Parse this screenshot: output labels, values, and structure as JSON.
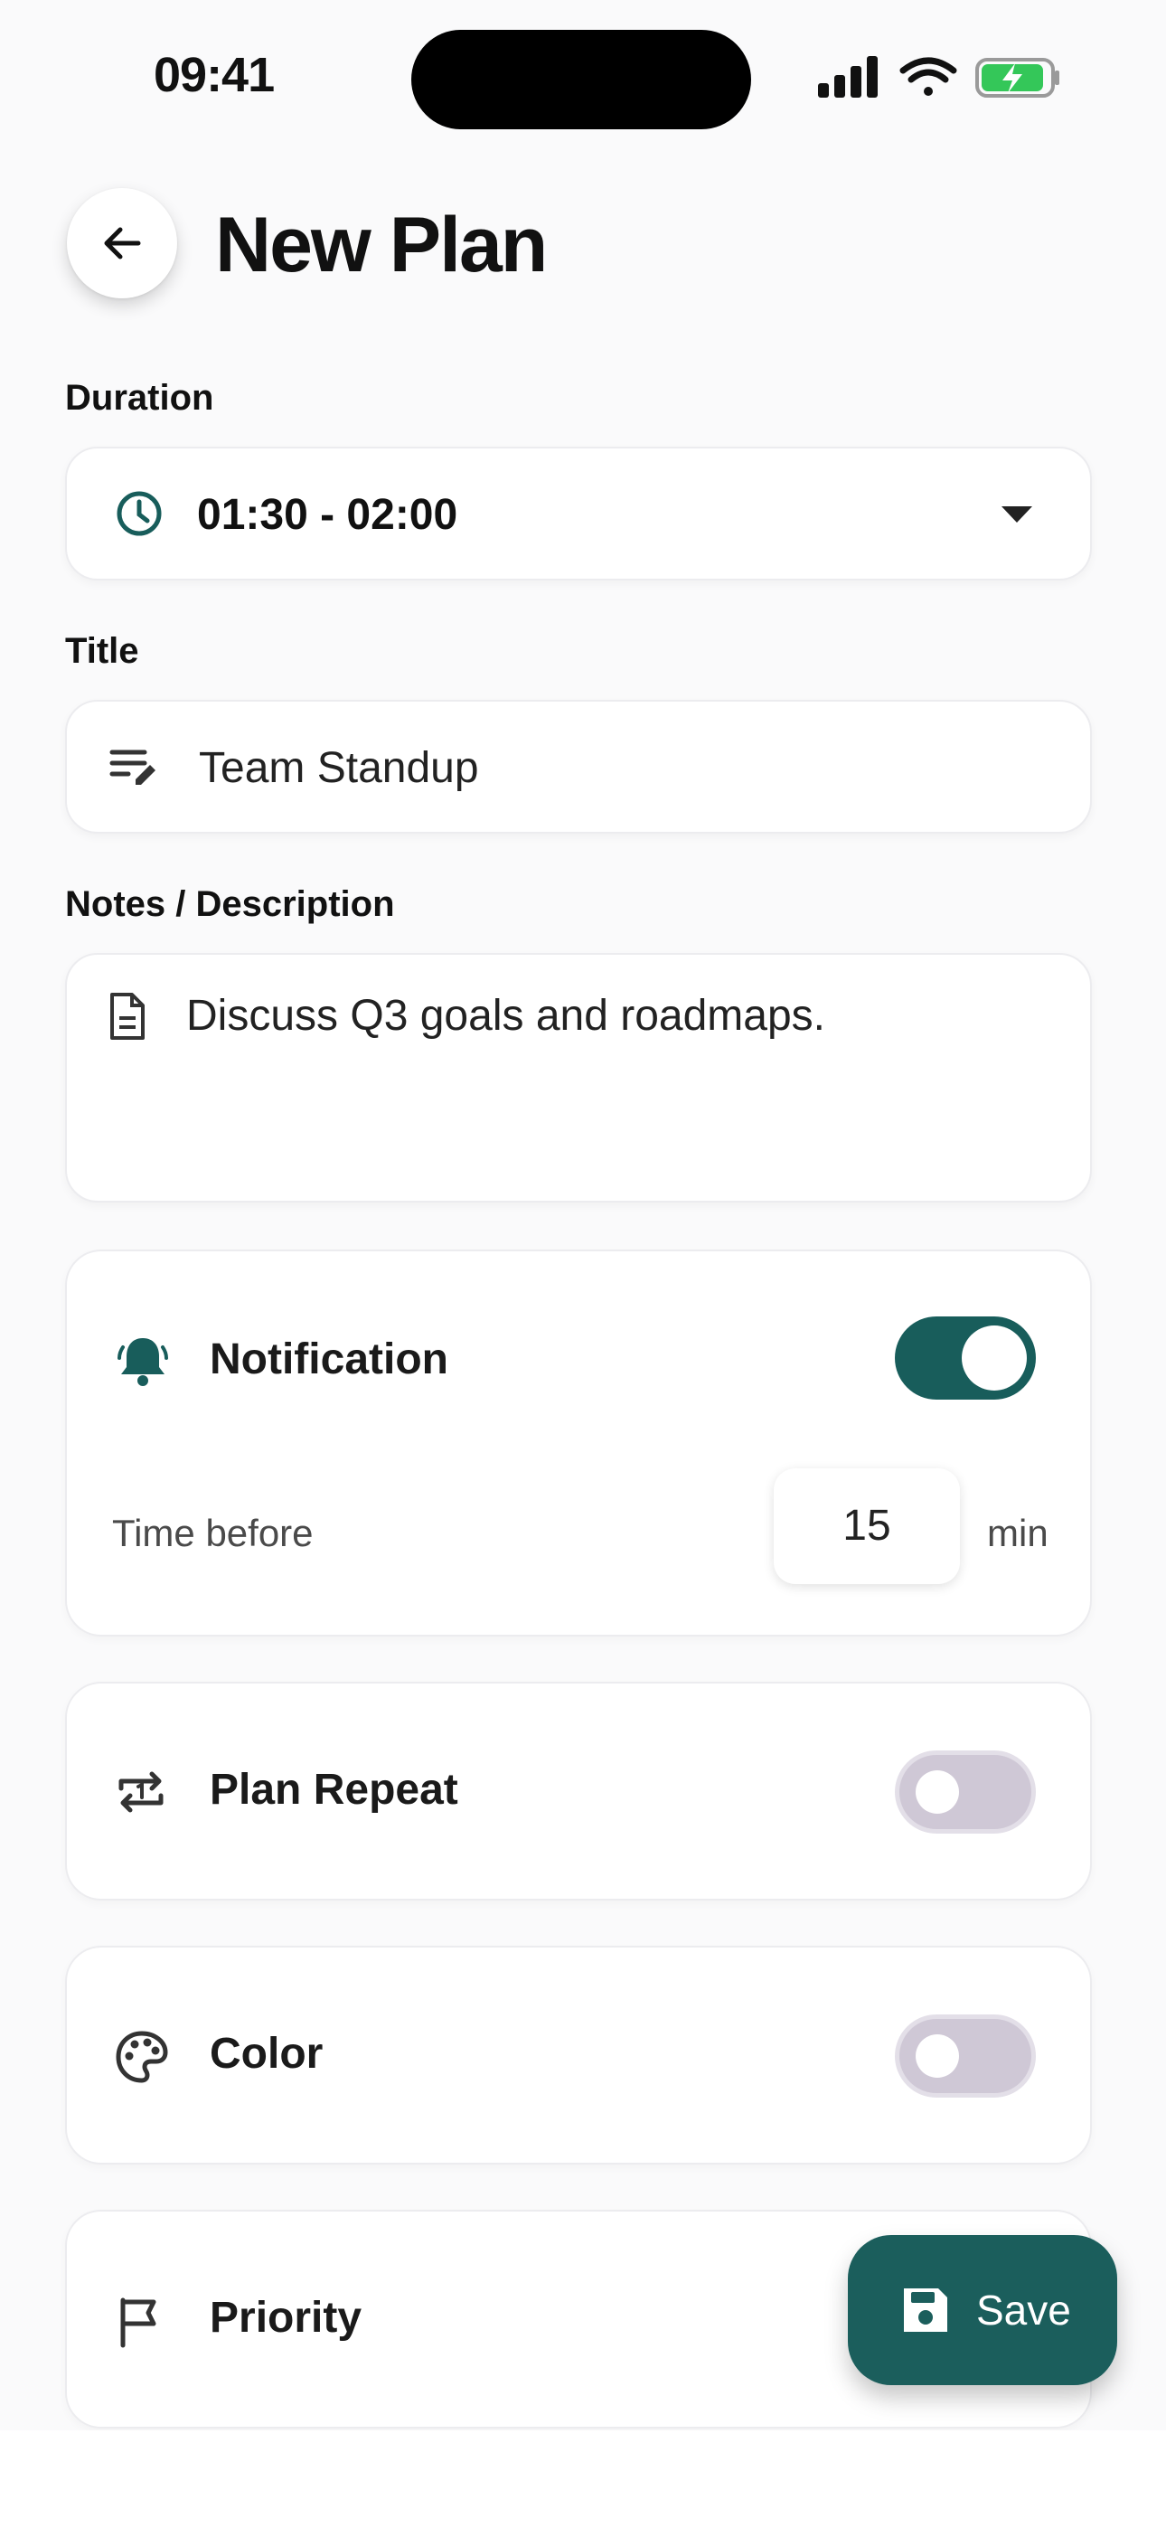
{
  "status_bar": {
    "time": "09:41"
  },
  "header": {
    "title": "New Plan"
  },
  "duration": {
    "label": "Duration",
    "value": "01:30 - 02:00"
  },
  "title_field": {
    "label": "Title",
    "value": "Team Standup"
  },
  "notes": {
    "label": "Notes / Description",
    "value": "Discuss Q3 goals and roadmaps."
  },
  "notification": {
    "title": "Notification",
    "enabled": true,
    "time_before_label": "Time before",
    "minutes": "15",
    "unit": "min"
  },
  "repeat": {
    "title": "Plan Repeat",
    "enabled": false
  },
  "color": {
    "title": "Color",
    "enabled": false
  },
  "priority": {
    "title": "Priority"
  },
  "save": {
    "label": "Save"
  },
  "colors": {
    "accent": "#185d5b",
    "toggle_off": "#cfc8d6",
    "battery": "#34c759"
  }
}
